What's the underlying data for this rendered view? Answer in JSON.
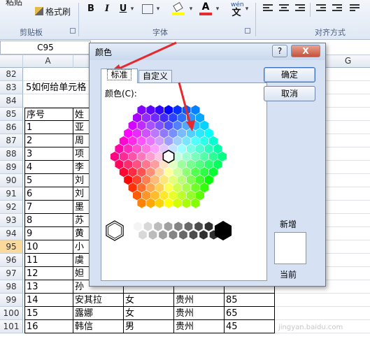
{
  "ribbon": {
    "paste_partial": "粘贴",
    "format_painter": "格式刷",
    "groups": {
      "clipboard": "剪贴板",
      "font": "字体",
      "alignment": "对齐方式"
    },
    "font_buttons": {
      "bold": "B",
      "italic": "I",
      "underline": "U",
      "phonetic": "wén"
    }
  },
  "formula_bar": {
    "name_box": "C95"
  },
  "columns": [
    "A",
    "G"
  ],
  "rows": [
    {
      "n": "82",
      "a": "",
      "b": "",
      "c": "",
      "d": "",
      "e": ""
    },
    {
      "n": "83",
      "a": "5如何给单元格",
      "b": "",
      "c": "",
      "d": "",
      "e": ""
    },
    {
      "n": "84",
      "a": "",
      "b": "",
      "c": "",
      "d": "",
      "e": ""
    },
    {
      "n": "85",
      "a": "序号",
      "b": "姓",
      "c": "",
      "d": "",
      "e": ""
    },
    {
      "n": "86",
      "a": "1",
      "b": "亚",
      "c": "",
      "d": "",
      "e": ""
    },
    {
      "n": "87",
      "a": "2",
      "b": "周",
      "c": "",
      "d": "",
      "e": ""
    },
    {
      "n": "88",
      "a": "3",
      "b": "项",
      "c": "",
      "d": "",
      "e": ""
    },
    {
      "n": "89",
      "a": "4",
      "b": "李",
      "c": "",
      "d": "",
      "e": ""
    },
    {
      "n": "90",
      "a": "5",
      "b": "刘",
      "c": "",
      "d": "",
      "e": ""
    },
    {
      "n": "91",
      "a": "6",
      "b": "刘",
      "c": "",
      "d": "",
      "e": ""
    },
    {
      "n": "92",
      "a": "7",
      "b": "墨",
      "c": "",
      "d": "",
      "e": ""
    },
    {
      "n": "93",
      "a": "8",
      "b": "苏",
      "c": "",
      "d": "",
      "e": ""
    },
    {
      "n": "94",
      "a": "9",
      "b": "黄",
      "c": "",
      "d": "",
      "e": ""
    },
    {
      "n": "95",
      "a": "10",
      "b": "小",
      "c": "",
      "d": "",
      "e": ""
    },
    {
      "n": "96",
      "a": "11",
      "b": "虞",
      "c": "",
      "d": "",
      "e": ""
    },
    {
      "n": "97",
      "a": "12",
      "b": "妲",
      "c": "",
      "d": "",
      "e": ""
    },
    {
      "n": "98",
      "a": "13",
      "b": "孙",
      "c": "",
      "d": "",
      "e": ""
    },
    {
      "n": "99",
      "a": "14",
      "b": "安其拉",
      "c": "女",
      "d": "贵州",
      "e": "85"
    },
    {
      "n": "100",
      "a": "15",
      "b": "露娜",
      "c": "女",
      "d": "贵州",
      "e": "65"
    },
    {
      "n": "101",
      "a": "16",
      "b": "韩信",
      "c": "男",
      "d": "贵州",
      "e": "45"
    }
  ],
  "dialog": {
    "title": "颜色",
    "help": "?",
    "close": "X",
    "tabs": {
      "standard": "标准",
      "custom": "自定义"
    },
    "colors_label": "颜色(C):",
    "ok": "确定",
    "cancel": "取消",
    "new_label": "新增",
    "current_label": "当前"
  },
  "palette_colors": {
    "accent_annotation": "#e8282d",
    "selection_highlight": "#f9d99c"
  },
  "watermark": "jingyan.baidu.com"
}
